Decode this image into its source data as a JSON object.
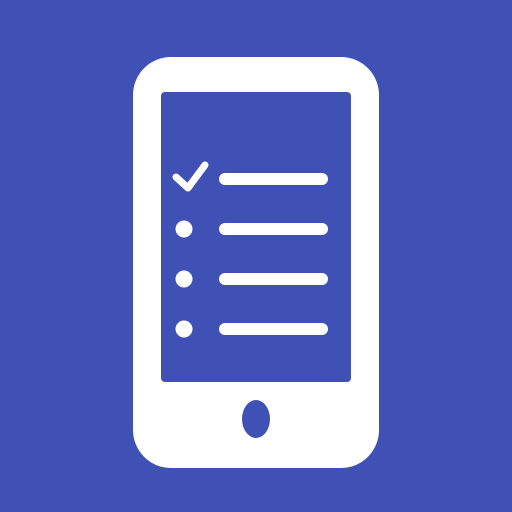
{
  "icon": {
    "name": "mobile-checklist-app-icon",
    "colors": {
      "background": "#3F51B5",
      "foreground": "#FFFFFF"
    },
    "checklist": {
      "items": [
        {
          "marker": "checkmark",
          "checked": true
        },
        {
          "marker": "bullet",
          "checked": false
        },
        {
          "marker": "bullet",
          "checked": false
        },
        {
          "marker": "bullet",
          "checked": false
        }
      ]
    }
  }
}
